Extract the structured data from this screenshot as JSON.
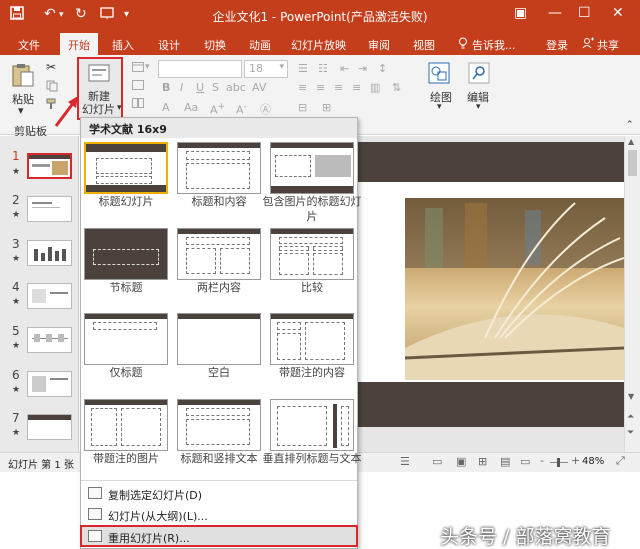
{
  "titlebar": {
    "title": "企业文化1 - PowerPoint(产品激活失败)",
    "save_icon": "save-icon",
    "undo_glyph": "↶",
    "redo_glyph": "↻",
    "minimize_glyph": "—",
    "restore_glyph": "☐",
    "close_glyph": "✕",
    "ribbon_opts_glyph": "▣"
  },
  "tabs": [
    "文件",
    "开始",
    "插入",
    "设计",
    "切换",
    "动画",
    "幻灯片放映",
    "审阅",
    "视图"
  ],
  "tell_me": "告诉我...",
  "login": "登录",
  "share": "共享",
  "ribbon": {
    "paste": "粘贴",
    "clipboard": "剪贴板",
    "new_slide_line1": "新建",
    "new_slide_line2": "幻灯片",
    "font_size": "18",
    "draw": "绘图",
    "edit": "编辑"
  },
  "thumbnails": [
    "1",
    "2",
    "3",
    "4",
    "5",
    "6",
    "7"
  ],
  "dropdown": {
    "header": "学术文献 16x9",
    "layouts": [
      "标题幻灯片",
      "标题和内容",
      "包含图片的标题幻灯片",
      "节标题",
      "两栏内容",
      "比较",
      "仅标题",
      "空白",
      "带题注的内容",
      "带题注的图片",
      "标题和竖排文本",
      "垂直排列标题与文本"
    ],
    "items": [
      "复制选定幻灯片(D)",
      "幻灯片(从大纲)(L)...",
      "重用幻灯片(R)..."
    ]
  },
  "status": {
    "slide_text": "幻灯片 第 1 张",
    "zoom": "48%",
    "minus": "-",
    "plus": "+"
  },
  "watermark": "头条号 / 部落窝教育",
  "colors": {
    "accent": "#c43e1c",
    "highlight_red": "#d8282b",
    "slide_dark": "#4b413d"
  }
}
